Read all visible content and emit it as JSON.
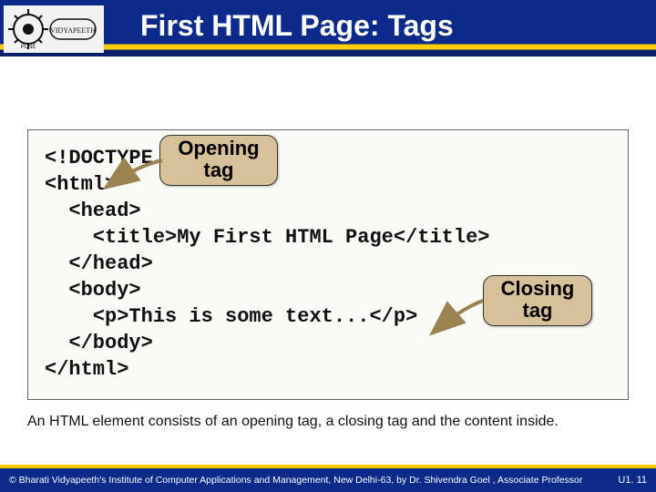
{
  "header": {
    "title": "First HTML Page: Tags"
  },
  "code": {
    "l1": "<!DOCTYPE HTML>",
    "l2": "<html>",
    "l3": "  <head>",
    "l4": "    <title>My First HTML Page</title>",
    "l5": "  </head>",
    "l6": "  <body>",
    "l7": "    <p>This is some text...</p>",
    "l8": "  </body>",
    "l9": "</html>"
  },
  "callouts": {
    "opening_line1": "Opening",
    "opening_line2": "tag",
    "closing_line1": "Closing",
    "closing_line2": "tag"
  },
  "caption": "An HTML element consists of an opening tag, a closing tag and the content inside.",
  "footer": {
    "copyright": "© Bharati Vidyapeeth's Institute of Computer Applications and Management, New Delhi-63, by Dr. Shivendra Goel , Associate Professor",
    "page": "U1. 11"
  }
}
